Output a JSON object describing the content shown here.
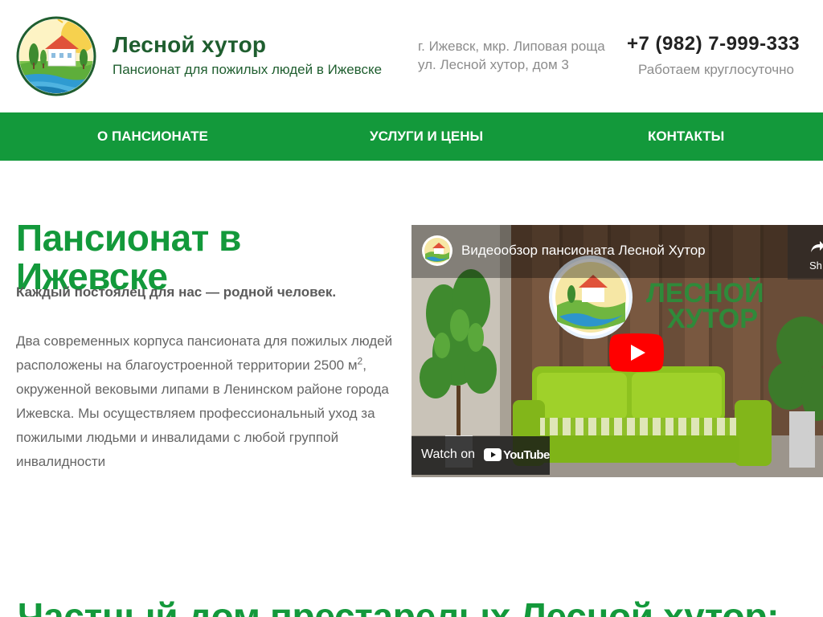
{
  "brand": {
    "name": "Лесной хутор",
    "tagline": "Пансионат для пожилых людей в Ижевске"
  },
  "contact": {
    "address_line1": "г. Ижевск, мкр. Липовая роща",
    "address_line2": "ул. Лесной хутор, дом 3",
    "phone": "+7 (982) 7-999-333",
    "hours": "Работаем круглосуточно"
  },
  "nav": {
    "items": [
      {
        "label": "О пансионате"
      },
      {
        "label": "Услуги и цены"
      },
      {
        "label": "Контакты"
      }
    ]
  },
  "hero": {
    "title": "Пансионат в Ижевске",
    "lead": "Каждый постоялец для нас — родной человек.",
    "text_before_sup": "Два современных корпуса пансионата для пожилых людей расположены на благоустроенной территории 2500 м",
    "sup": "2",
    "text_after_sup": ", окруженной вековыми липами в Ленинском районе города Ижевска. Мы осуществляем профессиональный уход за пожилыми людьми и инвалидами с любой группой",
    "text_last": "инвалидности"
  },
  "video": {
    "title": "Видеообзор пансионата Лесной Хутор",
    "share_label": "Sh",
    "watch_label": "Watch on",
    "youtube_label": "YouTube",
    "sign_line1": "ЛЕСНОЙ",
    "sign_line2": "ХУТОР"
  },
  "section": {
    "heading": "Частный дом престарелых Лесной хутор:"
  },
  "colors": {
    "brand_green": "#13993b",
    "dark_green": "#1f5e2f",
    "muted_text": "#8c8c8c",
    "youtube_red": "#ff0000"
  }
}
